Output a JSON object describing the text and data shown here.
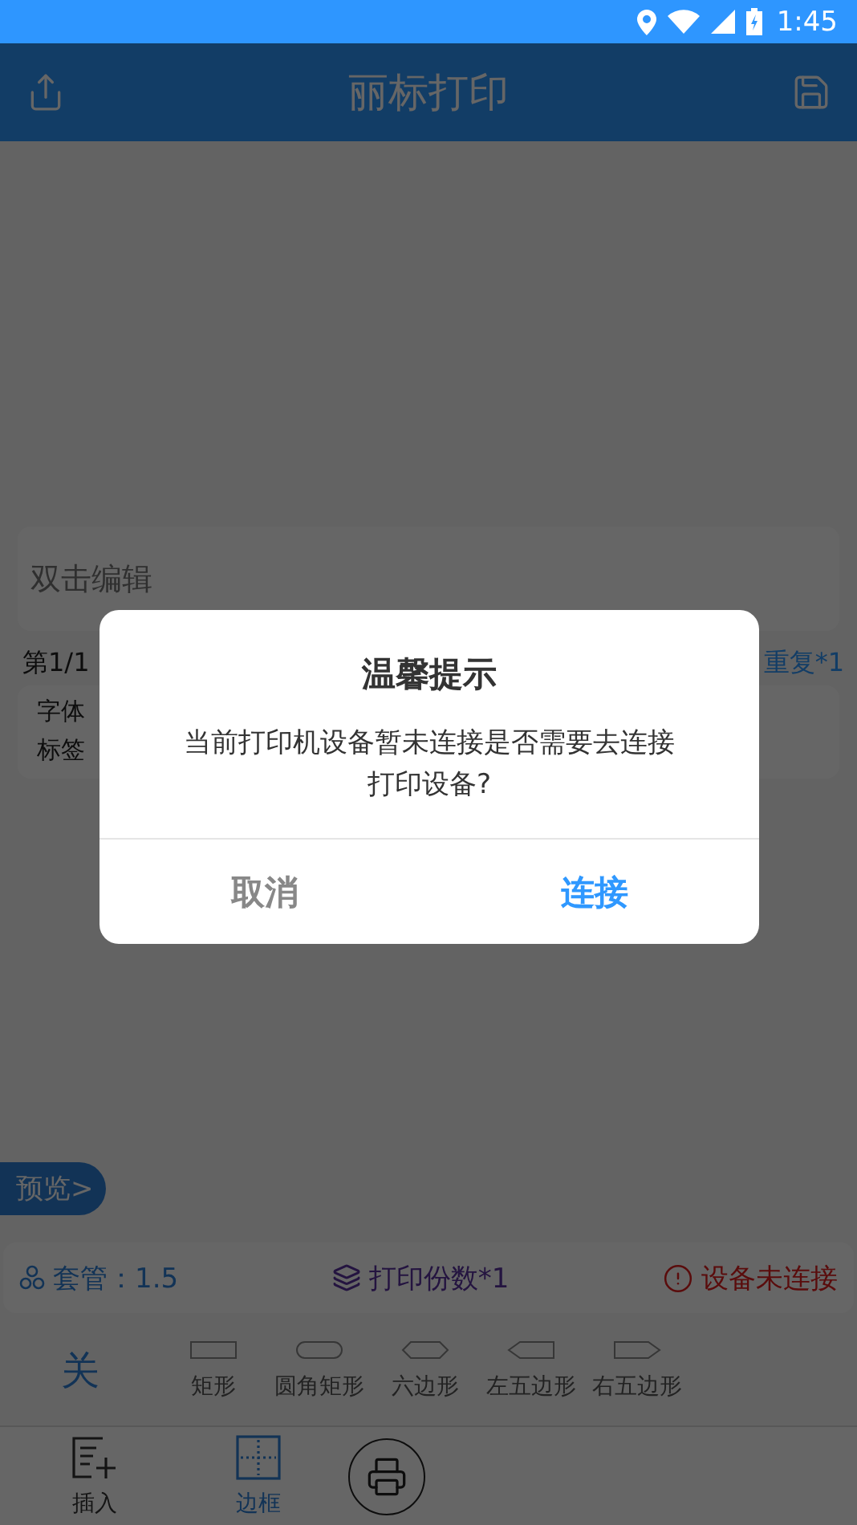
{
  "status_bar": {
    "time": "1:45"
  },
  "app_bar": {
    "title": "丽标打印"
  },
  "editor": {
    "placeholder": "双击编辑"
  },
  "page_info": {
    "page": "第1/1",
    "repeat": "重复*1"
  },
  "label_info": [
    "字体",
    "标签"
  ],
  "preview_button": "预览>",
  "print_status": {
    "sleeve": "套管：1.5",
    "copies": "打印份数*1",
    "device": "设备未连接"
  },
  "border_options": [
    {
      "label": "关",
      "kind": "text",
      "selected": true
    },
    {
      "label": "矩形",
      "kind": "rect",
      "selected": false
    },
    {
      "label": "圆角矩形",
      "kind": "rounded",
      "selected": false
    },
    {
      "label": "六边形",
      "kind": "hexagon",
      "selected": false
    },
    {
      "label": "左五边形",
      "kind": "left-pentagon",
      "selected": false
    },
    {
      "label": "右五边形",
      "kind": "right-pentagon",
      "selected": false
    }
  ],
  "nav": [
    {
      "label": "插入",
      "kind": "insert",
      "selected": false
    },
    {
      "label": "边框",
      "kind": "border",
      "selected": true
    },
    {
      "kind": "print",
      "selected": false
    }
  ],
  "dialog": {
    "title": "温馨提示",
    "message": "当前打印机设备暂未连接是否需要去连接打印设备?",
    "buttons": [
      {
        "label": "取消",
        "primary": false
      },
      {
        "label": "连接",
        "primary": true
      }
    ]
  }
}
